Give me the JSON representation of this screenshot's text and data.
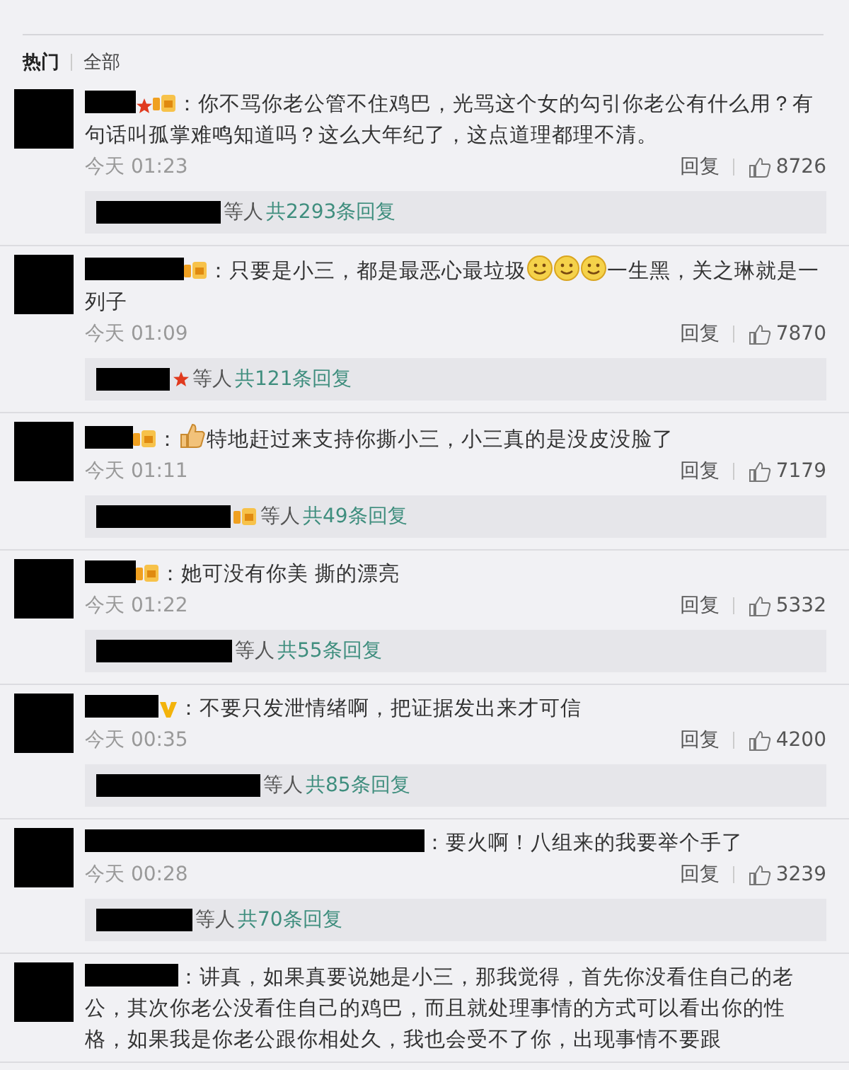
{
  "tabs": [
    {
      "label": "热门",
      "selected": true
    },
    {
      "label": "全部",
      "selected": false
    }
  ],
  "comments": [
    {
      "badges": [
        {
          "kind": "star"
        },
        {
          "kind": "level"
        }
      ],
      "content": [
        {
          "kind": "text",
          "text": "：你不骂你老公管不住鸡巴，光骂这个女的勾引你老公有什么用？有句话叫孤掌难鸣知道吗？这么大年纪了，这点道理都理不清。"
        }
      ],
      "time": "今天 01:23",
      "reply": "回复",
      "likes": "8726",
      "thread": {
        "suffix": "等人",
        "count": "共2293条回复"
      }
    },
    {
      "badges": [
        {
          "kind": "level"
        }
      ],
      "content": [
        {
          "kind": "text",
          "text": "：只要是小三，都是最恶心最垃圾"
        },
        {
          "kind": "emoji"
        },
        {
          "kind": "emoji"
        },
        {
          "kind": "emoji"
        },
        {
          "kind": "text",
          "text": "一生黑，关之琳就是一列子"
        }
      ],
      "time": "今天 01:09",
      "reply": "回复",
      "likes": "7870",
      "thread": {
        "badges": [
          {
            "kind": "star"
          }
        ],
        "suffix": "等人",
        "count": "共121条回复"
      }
    },
    {
      "badges": [
        {
          "kind": "level"
        }
      ],
      "content": [
        {
          "kind": "text",
          "text": "："
        },
        {
          "kind": "thumb"
        },
        {
          "kind": "text",
          "text": "特地赶过来支持你撕小三，小三真的是没皮没脸了"
        }
      ],
      "time": "今天 01:11",
      "reply": "回复",
      "likes": "7179",
      "thread": {
        "badges": [
          {
            "kind": "level"
          }
        ],
        "suffix": "等人",
        "count": "共49条回复"
      }
    },
    {
      "badges": [
        {
          "kind": "level"
        }
      ],
      "content": [
        {
          "kind": "text",
          "text": "：她可没有你美 撕的漂亮"
        }
      ],
      "time": "今天 01:22",
      "reply": "回复",
      "likes": "5332",
      "thread": {
        "suffix": "等人",
        "count": "共55条回复"
      }
    },
    {
      "badges": [
        {
          "kind": "vip"
        }
      ],
      "content": [
        {
          "kind": "text",
          "text": "：不要只发泄情绪啊，把证据发出来才可信"
        }
      ],
      "time": "今天 00:35",
      "reply": "回复",
      "likes": "4200",
      "thread": {
        "suffix": "等人",
        "count": "共85条回复"
      }
    },
    {
      "content": [
        {
          "kind": "text",
          "text": "：要火啊！八组来的我要举个手了"
        }
      ],
      "time": "今天 00:28",
      "reply": "回复",
      "likes": "3239",
      "thread": {
        "suffix": "等人",
        "count": "共70条回复"
      }
    },
    {
      "content": [
        {
          "kind": "text",
          "text": "：讲真，如果真要说她是小三，那我觉得，首先你没看住自己的老公，其次你老公没看住自己的鸡巴，而且就处理事情的方式可以看出你的性格，如果我是你老公跟你相处久，我也会受不了你，出现事情不要跟"
        }
      ]
    }
  ]
}
